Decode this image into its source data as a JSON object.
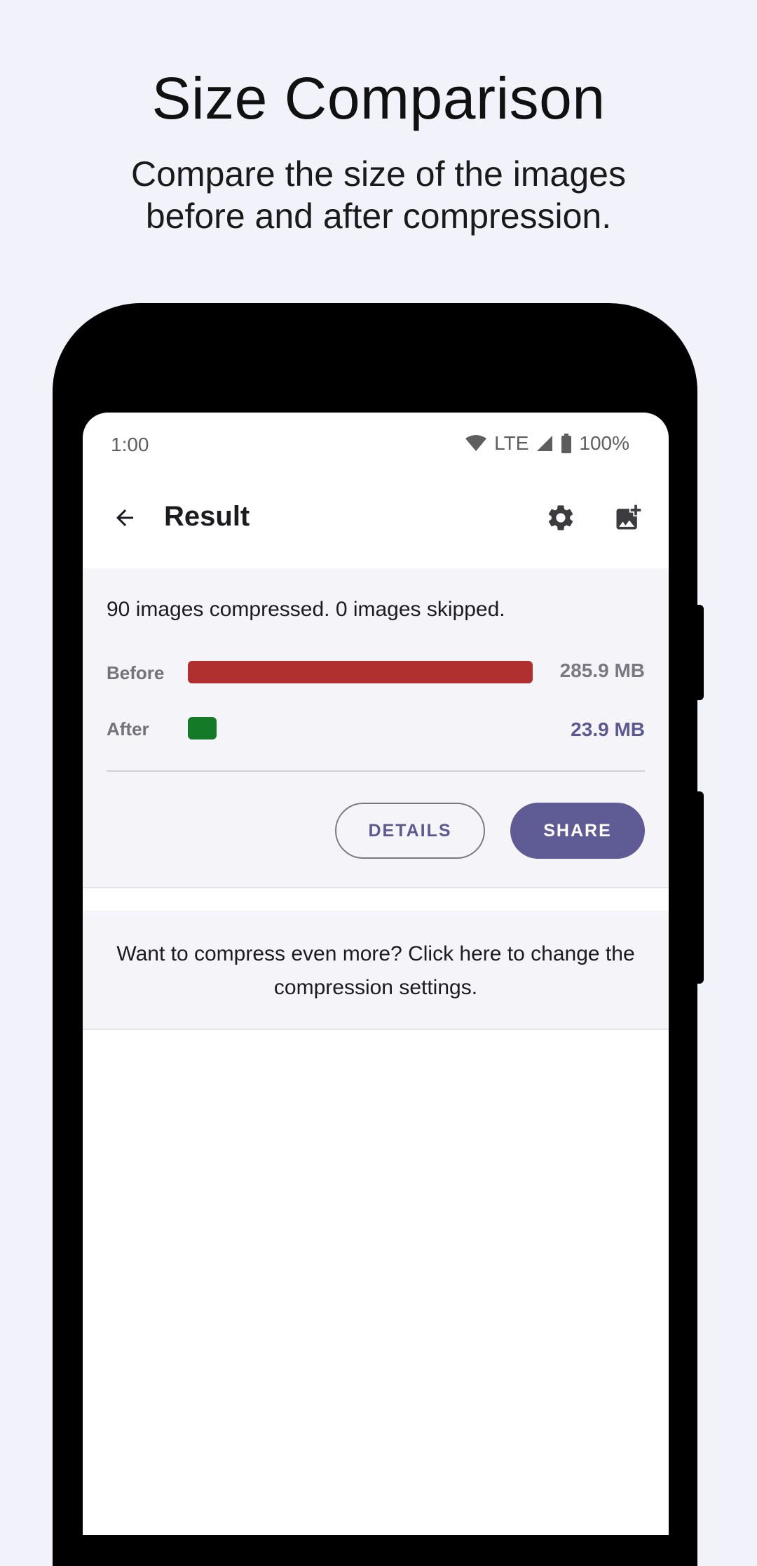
{
  "promo": {
    "title": "Size Comparison",
    "subtitle": "Compare the size of the images before and after compression."
  },
  "status_bar": {
    "time": "1:00",
    "network": "LTE",
    "battery": "100%",
    "icons": [
      "wifi-icon",
      "signal-icon",
      "battery-icon"
    ]
  },
  "app_bar": {
    "title": "Result",
    "icons": [
      "arrow-back-icon",
      "settings-gear-icon",
      "add-image-icon"
    ]
  },
  "result": {
    "summary": "90 images compressed. 0 images skipped.",
    "before_label": "Before",
    "after_label": "After",
    "before_size": "285.9 MB",
    "after_size": "23.9 MB",
    "before_mb": 285.9,
    "after_mb": 23.9,
    "details_label": "DETAILS",
    "share_label": "SHARE"
  },
  "hint": {
    "text": "Want to compress even more? Click here to change the compression settings."
  },
  "colors": {
    "accent": "#5f5b94",
    "before_bar": "#b03030",
    "after_bar": "#157a27",
    "background": "#f2f3fa"
  }
}
